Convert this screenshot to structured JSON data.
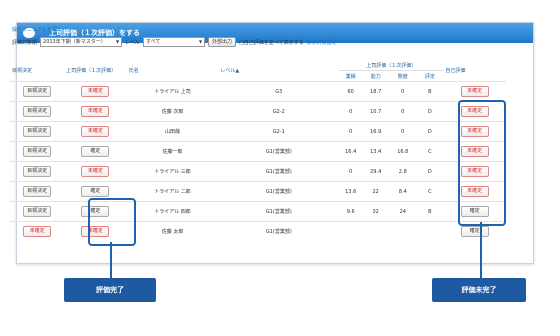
{
  "window": {
    "title": "上司評価（１次評価）をする"
  },
  "toolbar": {
    "manual_link": "操作マニュアルを開く",
    "period_label": "評価対象期",
    "period_value": "2013年下期（新マスター）",
    "level_label": "レベル",
    "level_value": "すべて",
    "export_button": "外部出力",
    "checkbox_label": "□自己評価を並べて表示する",
    "display_settings_link": "表示対象設定"
  },
  "table": {
    "headers": {
      "goal": "目標決定",
      "boss_eval": "上司評価（１次評価）",
      "name": "氏名",
      "level": "レベル▲",
      "group": "上司評価（１次評価）",
      "achievement": "業績",
      "ability": "能力",
      "attitude": "態度",
      "final": "評定",
      "self_eval": "自己評価"
    },
    "rows": [
      {
        "goal": "目標決定",
        "boss": "未確定",
        "name": "トライアル 上司",
        "level": "G3",
        "v1": "60",
        "v2": "18.7",
        "v3": "0",
        "grade": "B",
        "self": "未確定"
      },
      {
        "goal": "目標決定",
        "boss": "未確定",
        "name": "佐藤 次郎",
        "level": "G2-2",
        "v1": "0",
        "v2": "10.7",
        "v3": "0",
        "grade": "D",
        "self": "未確定"
      },
      {
        "goal": "目標決定",
        "boss": "未確定",
        "name": "山田哉",
        "level": "G2-1",
        "v1": "0",
        "v2": "16.9",
        "v3": "0",
        "grade": "D",
        "self": "未確定"
      },
      {
        "goal": "目標決定",
        "boss": "確定",
        "name": "佐藤一郎",
        "level": "G1(営業部)",
        "v1": "16.4",
        "v2": "13.4",
        "v3": "16.8",
        "grade": "C",
        "self": "未確定"
      },
      {
        "goal": "目標決定",
        "boss": "未確定",
        "name": "トライアル 三郎",
        "level": "G1(営業部)",
        "v1": "0",
        "v2": "29.4",
        "v3": "2.8",
        "grade": "D",
        "self": "未確定"
      },
      {
        "goal": "目標決定",
        "boss": "確定",
        "name": "トライアル 二郎",
        "level": "G1(営業部)",
        "v1": "13.6",
        "v2": "22",
        "v3": "8.4",
        "grade": "C",
        "self": "未確定"
      },
      {
        "goal": "目標決定",
        "boss": "確定",
        "name": "トライアル 四郎",
        "level": "G1(営業部)",
        "v1": "9.6",
        "v2": "32",
        "v3": "24",
        "grade": "B",
        "self": "確定"
      },
      {
        "goal": "未確定",
        "boss": "未確定",
        "name": "佐藤 太郎",
        "level": "G1(営業部)",
        "v1": "",
        "v2": "",
        "v3": "",
        "grade": "",
        "self": "確定"
      }
    ]
  },
  "callouts": {
    "done": "評価完了",
    "not_done": "評価未完了"
  },
  "colors": {
    "accent": "#1e5aa2",
    "title_bar": "#2c86d6",
    "unconfirmed": "#d22222"
  }
}
